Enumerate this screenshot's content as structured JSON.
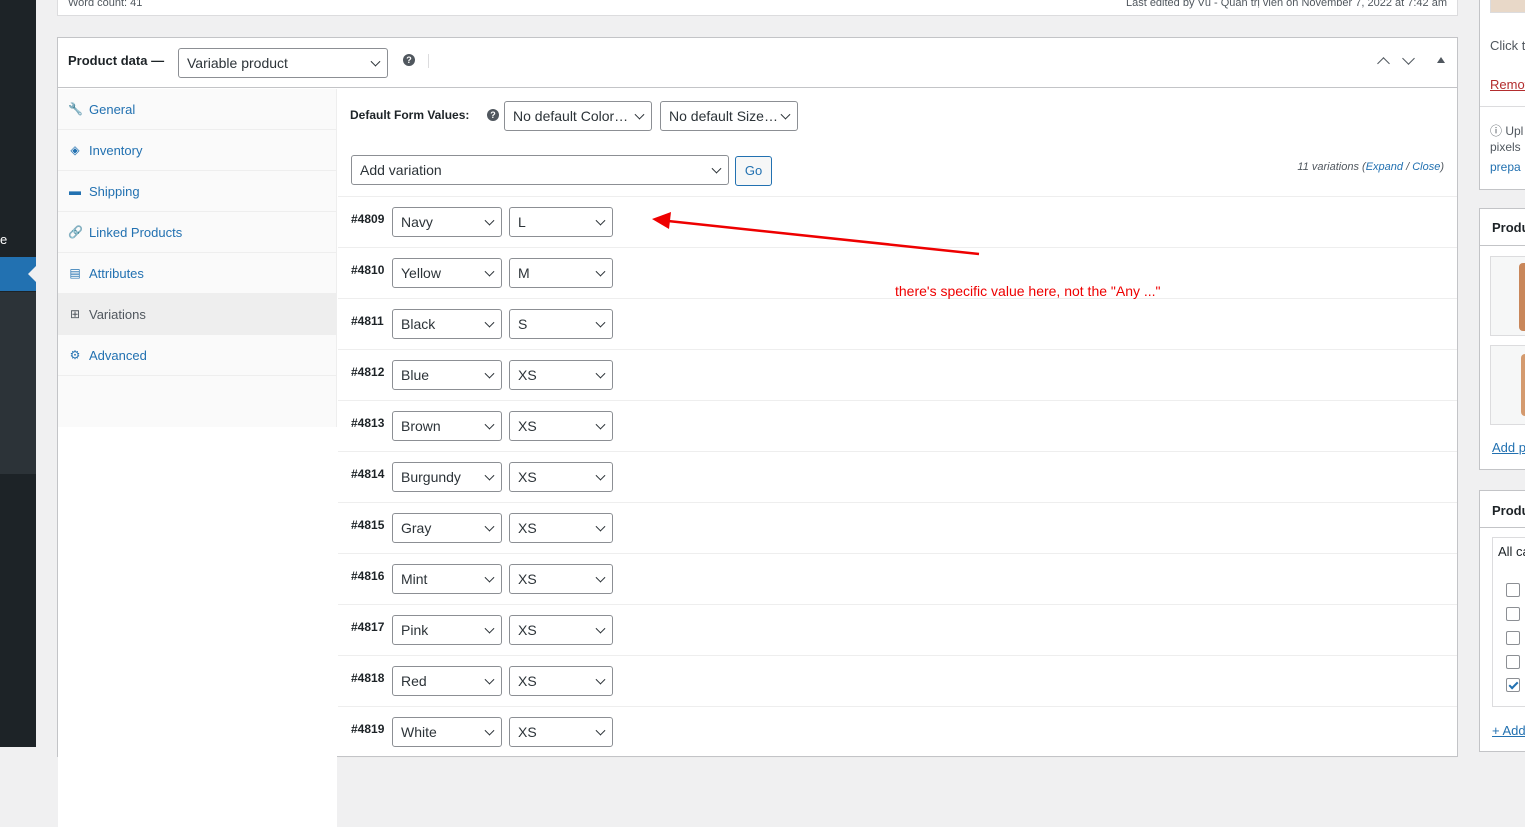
{
  "topbar": {
    "word_count": "Word count: 41",
    "last_edited": "Last edited by Vũ - Quản trị viên on November 7, 2022 at 7:42 am"
  },
  "left_menu": {
    "partial_text": "e"
  },
  "product_data": {
    "label": "Product data —",
    "type_select": "Variable product",
    "help_icon": "?"
  },
  "tabs": [
    {
      "label": "General",
      "icon": "wrench-icon",
      "glyph": "🔧"
    },
    {
      "label": "Inventory",
      "icon": "tag-icon",
      "glyph": "◈"
    },
    {
      "label": "Shipping",
      "icon": "truck-icon",
      "glyph": "▬"
    },
    {
      "label": "Linked Products",
      "icon": "link-icon",
      "glyph": "🔗"
    },
    {
      "label": "Attributes",
      "icon": "list-icon",
      "glyph": "▤"
    },
    {
      "label": "Variations",
      "icon": "grid-icon",
      "glyph": "⊞"
    },
    {
      "label": "Advanced",
      "icon": "gear-icon",
      "glyph": "⚙"
    }
  ],
  "variations": {
    "default_form_label": "Default Form Values:",
    "default_color": "No default Color…",
    "default_size": "No default Size…",
    "add_select": "Add variation",
    "go_label": "Go",
    "count_text": "11 variations",
    "expand": "Expand",
    "slash": " / ",
    "close": "Close",
    "rows": [
      {
        "id": "#4809",
        "color": "Navy",
        "size": "L"
      },
      {
        "id": "#4810",
        "color": "Yellow",
        "size": "M"
      },
      {
        "id": "#4811",
        "color": "Black",
        "size": "S"
      },
      {
        "id": "#4812",
        "color": "Blue",
        "size": "XS"
      },
      {
        "id": "#4813",
        "color": "Brown",
        "size": "XS"
      },
      {
        "id": "#4814",
        "color": "Burgundy",
        "size": "XS"
      },
      {
        "id": "#4815",
        "color": "Gray",
        "size": "XS"
      },
      {
        "id": "#4816",
        "color": "Mint",
        "size": "XS"
      },
      {
        "id": "#4817",
        "color": "Pink",
        "size": "XS"
      },
      {
        "id": "#4818",
        "color": "Red",
        "size": "XS"
      },
      {
        "id": "#4819",
        "color": "White",
        "size": "XS"
      }
    ]
  },
  "annotation": {
    "text": "there's specific value here, not the \"Any ...\"",
    "color": "#ee0000"
  },
  "right_column": {
    "click_text": "Click t",
    "remove_text": "Remov",
    "upload_text": "ⓘ Upl",
    "pixels_text": "pixels",
    "prepare_text": "prepa",
    "gallery_title": "Produ",
    "add_gallery": "Add p",
    "categories_title": "Produ",
    "all_categories": "All ca",
    "add_category": "+ Add"
  },
  "colors": {
    "accent": "#2271b1",
    "admin_dark": "#1d2327"
  }
}
